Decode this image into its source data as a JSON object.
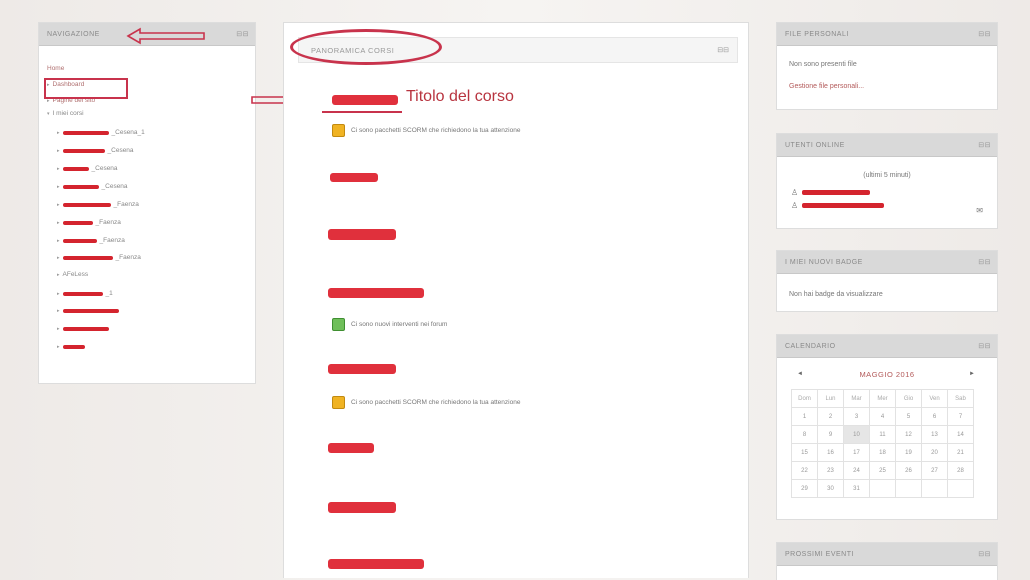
{
  "nav": {
    "title": "NAVIGAZIONE",
    "items": [
      {
        "label": "Home",
        "bullet": "",
        "suffix": ""
      },
      {
        "label": "Dashboard",
        "bullet": "▸",
        "suffix": ""
      },
      {
        "label": "Pagine del sito",
        "bullet": "▸",
        "suffix": ""
      },
      {
        "label": "I miei corsi",
        "bullet": "▾",
        "suffix": ""
      },
      {
        "label": "",
        "bullet": "▸",
        "suffix": "_Cesena_1"
      },
      {
        "label": "",
        "bullet": "▸",
        "suffix": "_Cesena"
      },
      {
        "label": "",
        "bullet": "▸",
        "suffix": "_Cesena"
      },
      {
        "label": "",
        "bullet": "▸",
        "suffix": "_Cesena"
      },
      {
        "label": "",
        "bullet": "▸",
        "suffix": "_Faenza"
      },
      {
        "label": "",
        "bullet": "▸",
        "suffix": "_Faenza"
      },
      {
        "label": "",
        "bullet": "▸",
        "suffix": "_Faenza"
      },
      {
        "label": "",
        "bullet": "▸",
        "suffix": "_Faenza"
      },
      {
        "label": "AFeLess",
        "bullet": "▸",
        "suffix": ""
      },
      {
        "label": "",
        "bullet": "▸",
        "suffix": "_1"
      },
      {
        "label": "",
        "bullet": "▸",
        "suffix": ""
      },
      {
        "label": "",
        "bullet": "▸",
        "suffix": ""
      },
      {
        "label": "",
        "bullet": "▸",
        "suffix": ""
      }
    ]
  },
  "main": {
    "title": "PANORAMICA CORSI",
    "course_title_label": "Titolo del corso",
    "notice_scorm": "Ci sono pacchetti SCORM che richiedono la tua attenzione",
    "notice_forum": "Ci sono nuovi interventi nei forum"
  },
  "files": {
    "title": "FILE PERSONALI",
    "empty": "Non sono presenti file",
    "manage": "Gestione file personali..."
  },
  "online": {
    "title": "UTENTI ONLINE",
    "subtitle": "(ultimi 5 minuti)"
  },
  "badges": {
    "title": "I MIEI NUOVI BADGE",
    "empty": "Non hai badge da visualizzare"
  },
  "calendar": {
    "title": "CALENDARIO",
    "month": "MAGGIO 2016",
    "prev": "◄",
    "next": "►",
    "weekdays": [
      "Dom",
      "Lun",
      "Mar",
      "Mer",
      "Gio",
      "Ven",
      "Sab"
    ],
    "weeks": [
      [
        "1",
        "2",
        "3",
        "4",
        "5",
        "6",
        "7"
      ],
      [
        "8",
        "9",
        "10",
        "11",
        "12",
        "13",
        "14"
      ],
      [
        "15",
        "16",
        "17",
        "18",
        "19",
        "20",
        "21"
      ],
      [
        "22",
        "23",
        "24",
        "25",
        "26",
        "27",
        "28"
      ],
      [
        "29",
        "30",
        "31",
        "",
        "",
        "",
        ""
      ]
    ],
    "today": "10"
  },
  "events": {
    "title": "PROSSIMI EVENTI"
  },
  "colors": {
    "accent": "#b35a5a",
    "annotation": "#c8334c",
    "redaction": "#e0303c"
  }
}
